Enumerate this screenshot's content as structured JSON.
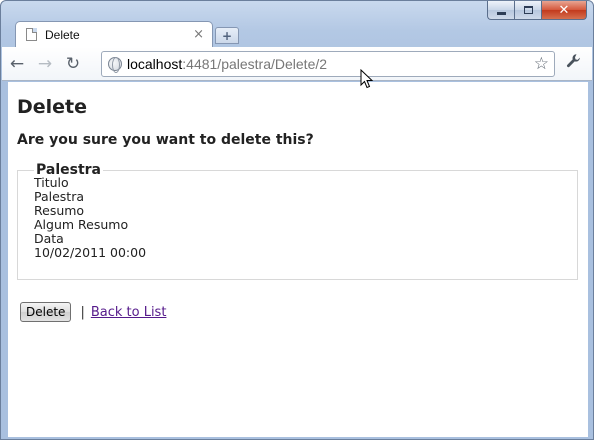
{
  "window": {
    "caption_min_icon": "minimize-icon",
    "caption_max_icon": "maximize-icon",
    "caption_close_icon": "close-icon",
    "caption_close_glyph": "✕"
  },
  "tab": {
    "title": "Delete",
    "close_glyph": "×",
    "new_tab_glyph": "+"
  },
  "toolbar": {
    "back_glyph": "←",
    "forward_glyph": "→",
    "reload_glyph": "↻",
    "url_host": "localhost",
    "url_rest": ":4481/palestra/Delete/2",
    "star_glyph": "☆",
    "wrench_glyph": "🔧"
  },
  "page": {
    "title": "Delete",
    "confirm": "Are you sure you want to delete this?",
    "fieldset_legend": "Palestra",
    "fields": [
      {
        "label": "Titulo",
        "value": "Palestra"
      },
      {
        "label": "Resumo",
        "value": "Algum Resumo"
      },
      {
        "label": "Data",
        "value": "10/02/2011 00:00"
      }
    ],
    "delete_button": "Delete",
    "separator": "|",
    "back_link": "Back to List"
  },
  "colors": {
    "link_visited": "#551a8b",
    "close_button": "#c23a1d"
  }
}
